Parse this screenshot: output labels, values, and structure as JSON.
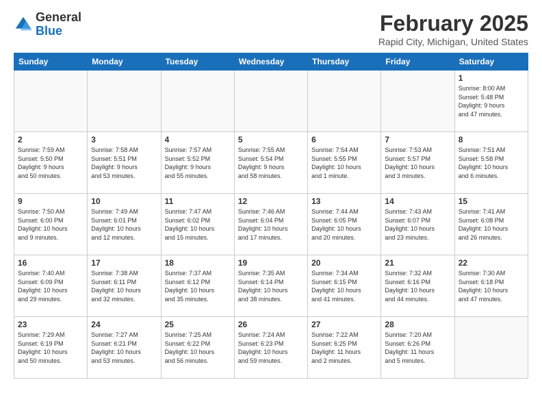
{
  "header": {
    "logo_general": "General",
    "logo_blue": "Blue",
    "month_year": "February 2025",
    "location": "Rapid City, Michigan, United States"
  },
  "weekdays": [
    "Sunday",
    "Monday",
    "Tuesday",
    "Wednesday",
    "Thursday",
    "Friday",
    "Saturday"
  ],
  "weeks": [
    [
      {
        "day": "",
        "info": ""
      },
      {
        "day": "",
        "info": ""
      },
      {
        "day": "",
        "info": ""
      },
      {
        "day": "",
        "info": ""
      },
      {
        "day": "",
        "info": ""
      },
      {
        "day": "",
        "info": ""
      },
      {
        "day": "1",
        "info": "Sunrise: 8:00 AM\nSunset: 5:48 PM\nDaylight: 9 hours\nand 47 minutes."
      }
    ],
    [
      {
        "day": "2",
        "info": "Sunrise: 7:59 AM\nSunset: 5:50 PM\nDaylight: 9 hours\nand 50 minutes."
      },
      {
        "day": "3",
        "info": "Sunrise: 7:58 AM\nSunset: 5:51 PM\nDaylight: 9 hours\nand 53 minutes."
      },
      {
        "day": "4",
        "info": "Sunrise: 7:57 AM\nSunset: 5:52 PM\nDaylight: 9 hours\nand 55 minutes."
      },
      {
        "day": "5",
        "info": "Sunrise: 7:55 AM\nSunset: 5:54 PM\nDaylight: 9 hours\nand 58 minutes."
      },
      {
        "day": "6",
        "info": "Sunrise: 7:54 AM\nSunset: 5:55 PM\nDaylight: 10 hours\nand 1 minute."
      },
      {
        "day": "7",
        "info": "Sunrise: 7:53 AM\nSunset: 5:57 PM\nDaylight: 10 hours\nand 3 minutes."
      },
      {
        "day": "8",
        "info": "Sunrise: 7:51 AM\nSunset: 5:58 PM\nDaylight: 10 hours\nand 6 minutes."
      }
    ],
    [
      {
        "day": "9",
        "info": "Sunrise: 7:50 AM\nSunset: 6:00 PM\nDaylight: 10 hours\nand 9 minutes."
      },
      {
        "day": "10",
        "info": "Sunrise: 7:49 AM\nSunset: 6:01 PM\nDaylight: 10 hours\nand 12 minutes."
      },
      {
        "day": "11",
        "info": "Sunrise: 7:47 AM\nSunset: 6:02 PM\nDaylight: 10 hours\nand 15 minutes."
      },
      {
        "day": "12",
        "info": "Sunrise: 7:46 AM\nSunset: 6:04 PM\nDaylight: 10 hours\nand 17 minutes."
      },
      {
        "day": "13",
        "info": "Sunrise: 7:44 AM\nSunset: 6:05 PM\nDaylight: 10 hours\nand 20 minutes."
      },
      {
        "day": "14",
        "info": "Sunrise: 7:43 AM\nSunset: 6:07 PM\nDaylight: 10 hours\nand 23 minutes."
      },
      {
        "day": "15",
        "info": "Sunrise: 7:41 AM\nSunset: 6:08 PM\nDaylight: 10 hours\nand 26 minutes."
      }
    ],
    [
      {
        "day": "16",
        "info": "Sunrise: 7:40 AM\nSunset: 6:09 PM\nDaylight: 10 hours\nand 29 minutes."
      },
      {
        "day": "17",
        "info": "Sunrise: 7:38 AM\nSunset: 6:11 PM\nDaylight: 10 hours\nand 32 minutes."
      },
      {
        "day": "18",
        "info": "Sunrise: 7:37 AM\nSunset: 6:12 PM\nDaylight: 10 hours\nand 35 minutes."
      },
      {
        "day": "19",
        "info": "Sunrise: 7:35 AM\nSunset: 6:14 PM\nDaylight: 10 hours\nand 38 minutes."
      },
      {
        "day": "20",
        "info": "Sunrise: 7:34 AM\nSunset: 6:15 PM\nDaylight: 10 hours\nand 41 minutes."
      },
      {
        "day": "21",
        "info": "Sunrise: 7:32 AM\nSunset: 6:16 PM\nDaylight: 10 hours\nand 44 minutes."
      },
      {
        "day": "22",
        "info": "Sunrise: 7:30 AM\nSunset: 6:18 PM\nDaylight: 10 hours\nand 47 minutes."
      }
    ],
    [
      {
        "day": "23",
        "info": "Sunrise: 7:29 AM\nSunset: 6:19 PM\nDaylight: 10 hours\nand 50 minutes."
      },
      {
        "day": "24",
        "info": "Sunrise: 7:27 AM\nSunset: 6:21 PM\nDaylight: 10 hours\nand 53 minutes."
      },
      {
        "day": "25",
        "info": "Sunrise: 7:25 AM\nSunset: 6:22 PM\nDaylight: 10 hours\nand 56 minutes."
      },
      {
        "day": "26",
        "info": "Sunrise: 7:24 AM\nSunset: 6:23 PM\nDaylight: 10 hours\nand 59 minutes."
      },
      {
        "day": "27",
        "info": "Sunrise: 7:22 AM\nSunset: 6:25 PM\nDaylight: 11 hours\nand 2 minutes."
      },
      {
        "day": "28",
        "info": "Sunrise: 7:20 AM\nSunset: 6:26 PM\nDaylight: 11 hours\nand 5 minutes."
      },
      {
        "day": "",
        "info": ""
      }
    ]
  ]
}
